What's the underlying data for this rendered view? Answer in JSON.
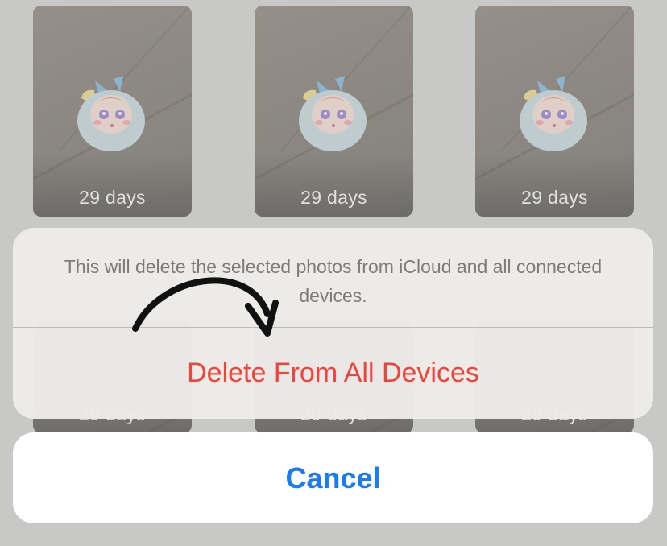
{
  "photos": {
    "row1": [
      {
        "label": "29 days"
      },
      {
        "label": "29 days"
      },
      {
        "label": "29 days"
      }
    ],
    "row2": [
      {
        "label": "29 days"
      },
      {
        "label": "29 days"
      },
      {
        "label": "29 days"
      }
    ]
  },
  "action_sheet": {
    "message": "This will delete the selected photos from iCloud and all connected devices.",
    "delete_label": "Delete From All Devices",
    "cancel_label": "Cancel"
  },
  "colors": {
    "destructive": "#f0443a",
    "accent": "#1a7cf0"
  },
  "icons": {
    "annotation": "curved-arrow-icon"
  }
}
